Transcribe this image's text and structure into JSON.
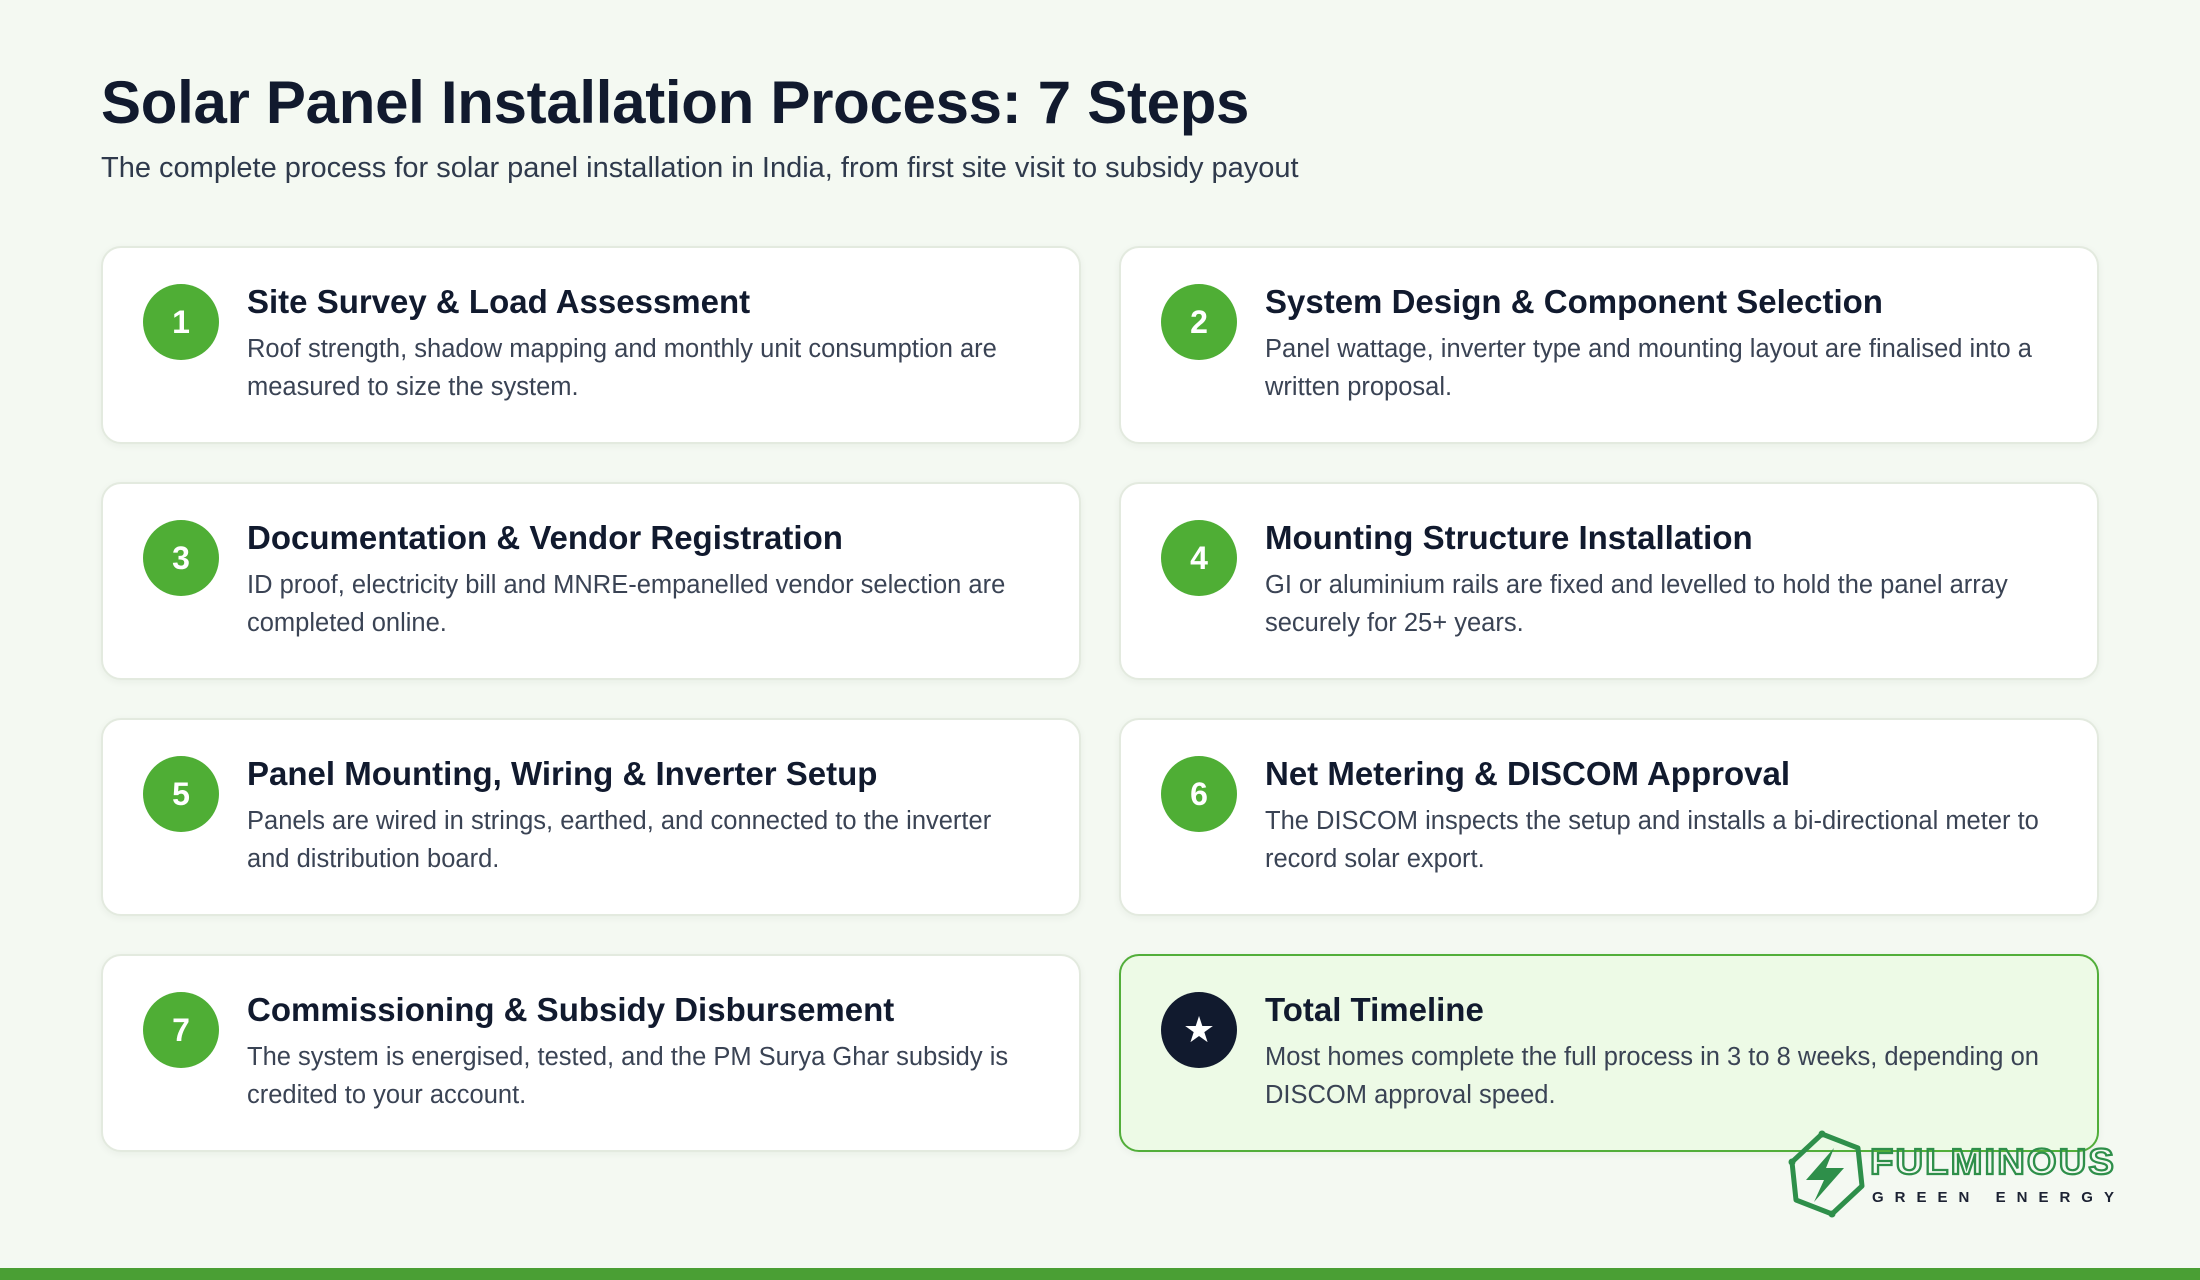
{
  "header": {
    "title": "Solar Panel Installation Process: 7 Steps",
    "subtitle": "The complete process for solar panel installation in India, from first site visit to subsidy payout"
  },
  "steps": [
    {
      "number": "1",
      "title": "Site Survey & Load Assessment",
      "description": "Roof strength, shadow mapping and monthly unit consumption are measured to size the system."
    },
    {
      "number": "2",
      "title": "System Design & Component Selection",
      "description": "Panel wattage, inverter type and mounting layout are finalised into a written proposal."
    },
    {
      "number": "3",
      "title": "Documentation & Vendor Registration",
      "description": "ID proof, electricity bill and MNRE-empanelled vendor selection are completed online."
    },
    {
      "number": "4",
      "title": "Mounting Structure Installation",
      "description": "GI or aluminium rails are fixed and levelled to hold the panel array securely for 25+ years."
    },
    {
      "number": "5",
      "title": "Panel Mounting, Wiring & Inverter Setup",
      "description": "Panels are wired in strings, earthed, and connected to the inverter and distribution board."
    },
    {
      "number": "6",
      "title": "Net Metering & DISCOM Approval",
      "description": "The DISCOM inspects the setup and installs a bi-directional meter to record solar export."
    },
    {
      "number": "7",
      "title": "Commissioning & Subsidy Disbursement",
      "description": "The system is energised, tested, and the PM Surya Ghar subsidy is credited to your account."
    }
  ],
  "summary": {
    "icon": "★",
    "icon_name": "star-icon",
    "title": "Total Timeline",
    "description": "Most homes complete the full process in 3 to 8 weeks, depending on DISCOM approval speed."
  },
  "logo": {
    "brand": "FULMINOUS",
    "tagline": "GREEN ENERGY",
    "icon_name": "lightning-hexagon-icon"
  },
  "colors": {
    "accent": "#4fae35",
    "dark": "#111a2e",
    "background": "#f4f9f2",
    "highlight_bg": "#edfae6",
    "bottom_bar": "#4a9f34"
  }
}
